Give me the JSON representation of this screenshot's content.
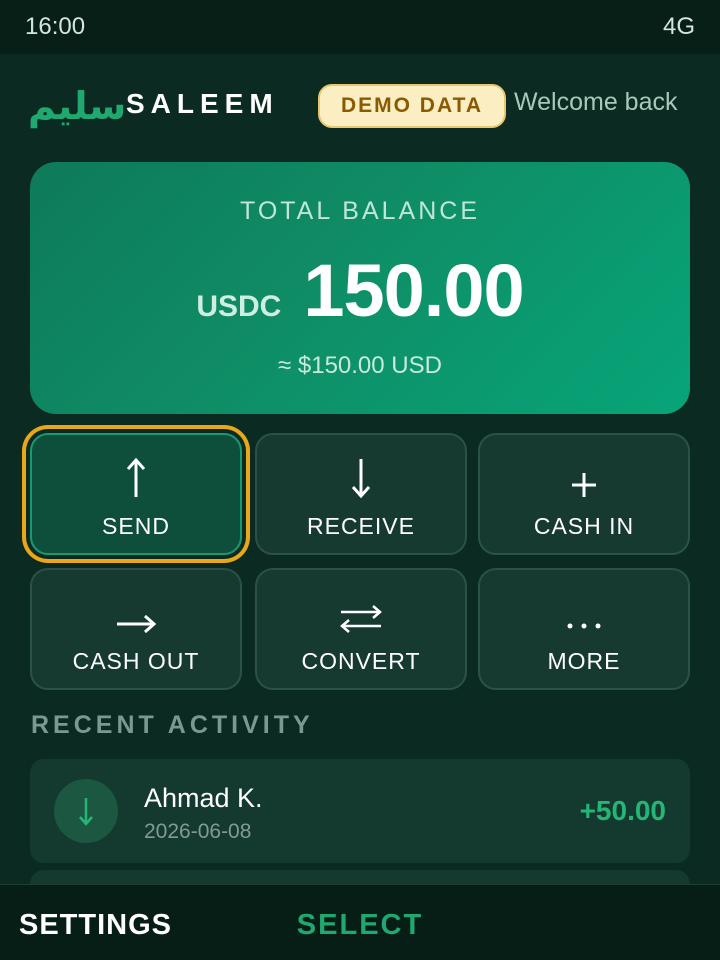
{
  "status_bar": {
    "time": "16:00",
    "network": "4G"
  },
  "header": {
    "logo_arabic": "سليم",
    "logo_text": "SALEEM",
    "demo_badge": "DEMO DATA",
    "welcome": "Welcome back"
  },
  "balance": {
    "label": "TOTAL BALANCE",
    "currency": "USDC",
    "amount": "150.00",
    "usd_equivalent": "≈ $150.00 USD"
  },
  "actions": [
    {
      "label": "SEND",
      "icon": "arrow-up-icon",
      "selected": true
    },
    {
      "label": "RECEIVE",
      "icon": "arrow-down-icon",
      "selected": false
    },
    {
      "label": "CASH IN",
      "icon": "plus-icon",
      "selected": false
    },
    {
      "label": "CASH OUT",
      "icon": "arrow-right-icon",
      "selected": false
    },
    {
      "label": "CONVERT",
      "icon": "swap-arrows-icon",
      "selected": false
    },
    {
      "label": "MORE",
      "icon": "more-dots-icon",
      "selected": false
    }
  ],
  "recent_activity": {
    "title": "RECENT ACTIVITY",
    "items": [
      {
        "name": "Ahmad K.",
        "date": "2026-06-08",
        "amount": "+50.00",
        "icon": "arrow-down-icon"
      }
    ]
  },
  "softkeys": {
    "left": "SETTINGS",
    "center": "SELECT"
  },
  "colors": {
    "background": "#0b2b22",
    "accent_green": "#1fa870",
    "positive_amount": "#25b576",
    "focus_ring": "#e8a81a",
    "demo_badge_bg": "#fbeec2"
  }
}
